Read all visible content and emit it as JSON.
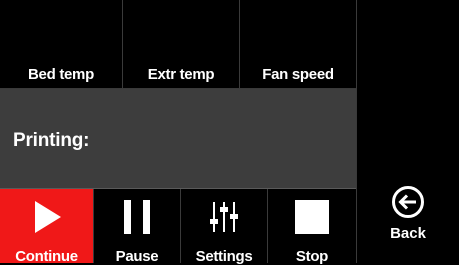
{
  "status_row": {
    "bed_temp_label": "Bed temp",
    "extr_temp_label": "Extr temp",
    "fan_speed_label": "Fan speed"
  },
  "status_bar": {
    "text": "Printing:"
  },
  "toolbar": {
    "continue_label": "Continue",
    "pause_label": "Pause",
    "settings_label": "Settings",
    "stop_label": "Stop",
    "icons": {
      "continue": "play-icon",
      "pause": "pause-icon",
      "settings": "sliders-icon",
      "stop": "stop-icon"
    }
  },
  "right_panel": {
    "back_label": "Back",
    "back_icon": "back-arrow-icon"
  },
  "colors": {
    "background": "#000000",
    "panel": "#3d3d3d",
    "accent_active": "#f01818",
    "text": "#ffffff"
  }
}
